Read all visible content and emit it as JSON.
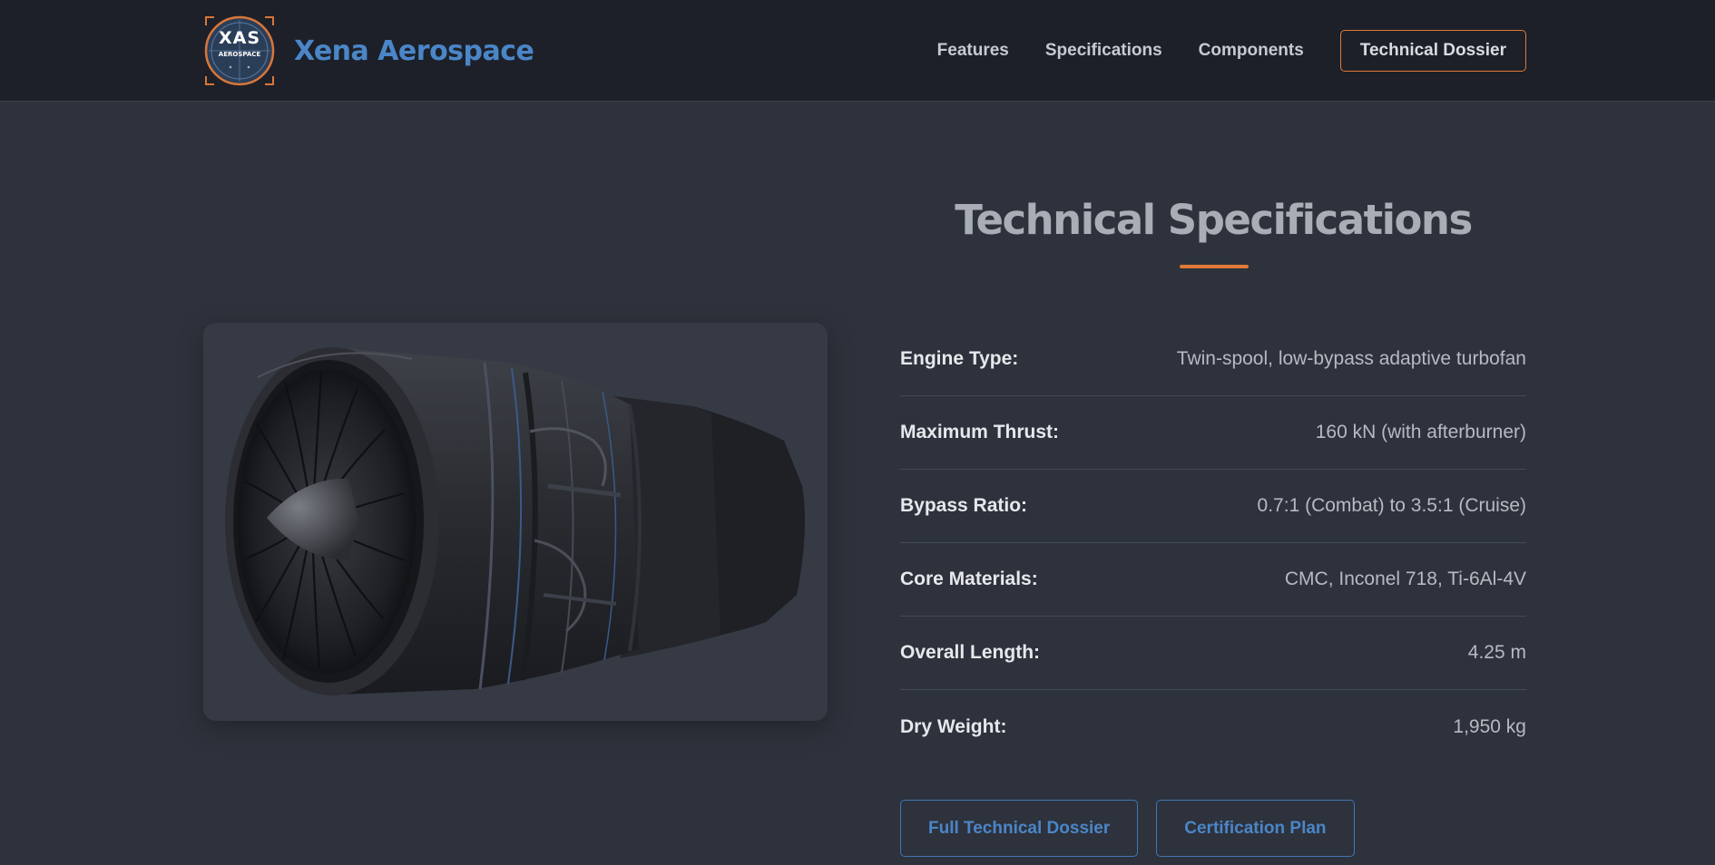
{
  "header": {
    "logo": {
      "line1": "XAS",
      "line2": "AEROSPACE"
    },
    "brand_name": "Xena Aerospace",
    "nav": [
      "Features",
      "Specifications",
      "Components"
    ],
    "cta": "Technical Dossier"
  },
  "main": {
    "title": "Technical Specifications",
    "specs": [
      {
        "label": "Engine Type:",
        "value": "Twin-spool, low-bypass adaptive turbofan"
      },
      {
        "label": "Maximum Thrust:",
        "value": "160 kN (with afterburner)"
      },
      {
        "label": "Bypass Ratio:",
        "value": "0.7:1 (Combat) to 3.5:1 (Cruise)"
      },
      {
        "label": "Core Materials:",
        "value": "CMC, Inconel 718, Ti-6Al-4V"
      },
      {
        "label": "Overall Length:",
        "value": "4.25 m"
      },
      {
        "label": "Dry Weight:",
        "value": "1,950 kg"
      }
    ],
    "buttons": [
      "Full Technical Dossier",
      "Certification Plan"
    ]
  },
  "colors": {
    "accent": "#e07a36",
    "brand": "#4a86c8",
    "background": "#2e323c",
    "header": "#1d2028"
  },
  "icons": [
    "xas-logo-icon",
    "turbofan-engine-image"
  ]
}
